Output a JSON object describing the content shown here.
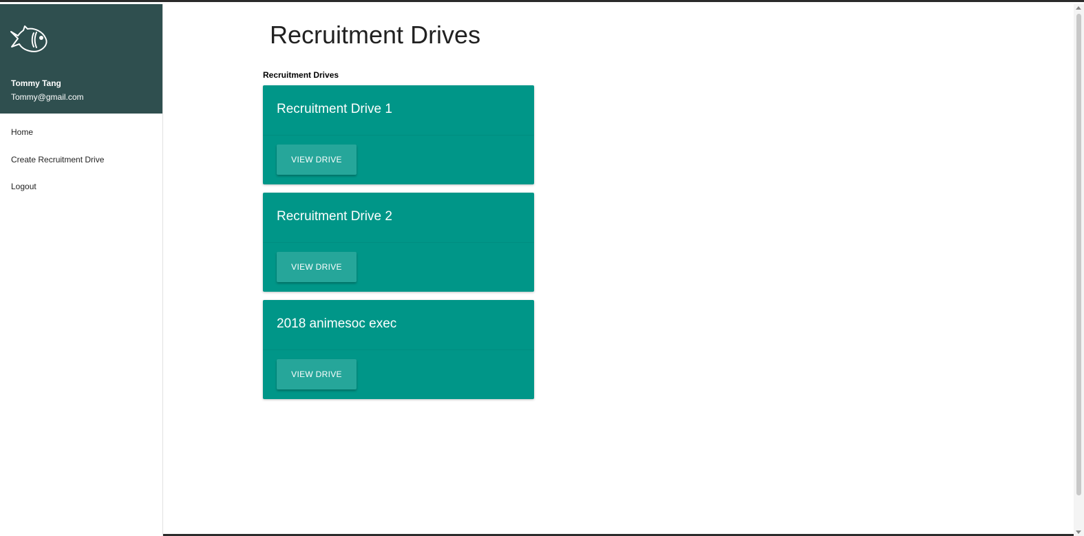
{
  "user": {
    "name": "Tommy Tang",
    "email": "Tommy@gmail.com",
    "logo_icon": "fish-icon"
  },
  "nav": {
    "items": [
      {
        "label": "Home"
      },
      {
        "label": "Create Recruitment Drive"
      },
      {
        "label": "Logout"
      }
    ]
  },
  "main": {
    "title": "Recruitment Drives",
    "section_label": "Recruitment Drives",
    "cards": [
      {
        "title": "Recruitment Drive 1",
        "button": "VIEW DRIVE"
      },
      {
        "title": "Recruitment Drive 2",
        "button": "VIEW DRIVE"
      },
      {
        "title": "2018 animesoc exec",
        "button": "VIEW DRIVE"
      }
    ]
  },
  "colors": {
    "sidebar_header": "#2f4f4f",
    "card": "#009688",
    "button": "#26a69a"
  }
}
